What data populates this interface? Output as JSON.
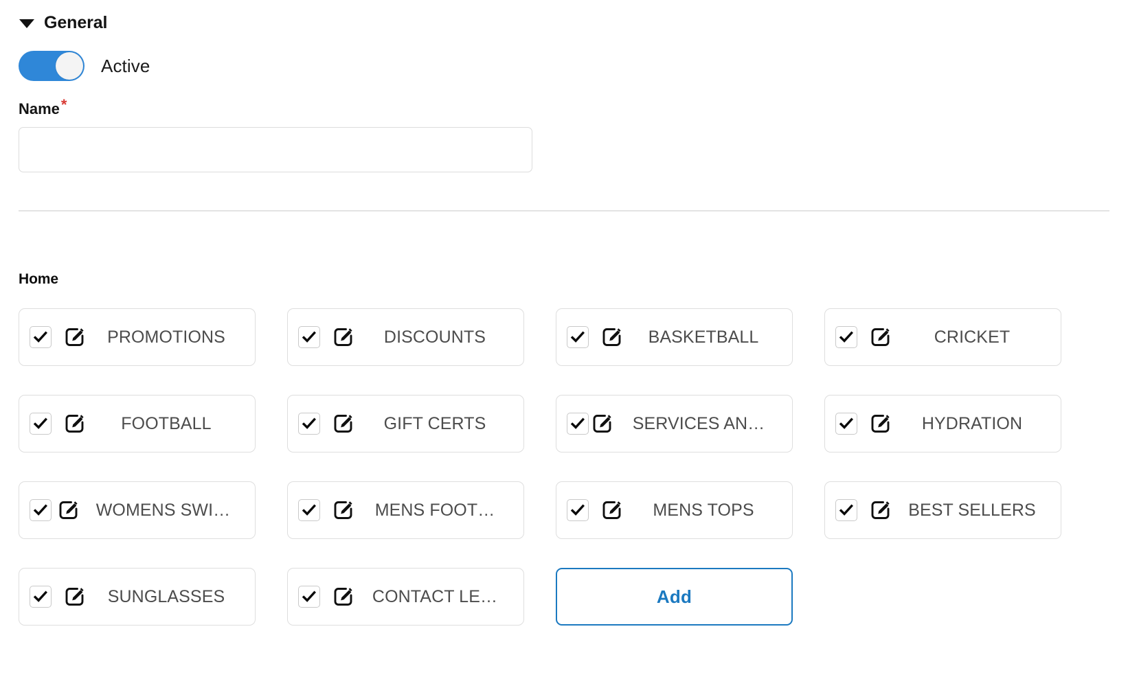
{
  "section": {
    "title": "General",
    "caret_icon": "chevron-down-icon",
    "expanded": true
  },
  "toggle": {
    "label": "Active",
    "state": "on",
    "on_color": "#2f87d8",
    "knob_color": "#f4f4f4"
  },
  "name_field": {
    "label": "Name",
    "required_marker": "*",
    "required_color": "#d83a34",
    "value": "",
    "placeholder": ""
  },
  "home_group": {
    "title": "Home",
    "chips": [
      {
        "label": "PROMOTIONS",
        "checked": true,
        "checkbox_icon": "checkbox-checked-icon",
        "edit_icon": "edit-pencil-icon",
        "spacing": "normal"
      },
      {
        "label": "DISCOUNTS",
        "checked": true,
        "checkbox_icon": "checkbox-checked-icon",
        "edit_icon": "edit-pencil-icon",
        "spacing": "normal"
      },
      {
        "label": "BASKETBALL",
        "checked": true,
        "checkbox_icon": "checkbox-checked-icon",
        "edit_icon": "edit-pencil-icon",
        "spacing": "normal"
      },
      {
        "label": "CRICKET",
        "checked": true,
        "checkbox_icon": "checkbox-checked-icon",
        "edit_icon": "edit-pencil-icon",
        "spacing": "normal"
      },
      {
        "label": "FOOTBALL",
        "checked": true,
        "checkbox_icon": "checkbox-checked-icon",
        "edit_icon": "edit-pencil-icon",
        "spacing": "normal"
      },
      {
        "label": "GIFT CERTS",
        "checked": true,
        "checkbox_icon": "checkbox-checked-icon",
        "edit_icon": "edit-pencil-icon",
        "spacing": "normal"
      },
      {
        "label": "SERVICES AN…",
        "checked": true,
        "checkbox_icon": "checkbox-checked-icon",
        "edit_icon": "edit-pencil-icon",
        "spacing": "tight"
      },
      {
        "label": "HYDRATION",
        "checked": true,
        "checkbox_icon": "checkbox-checked-icon",
        "edit_icon": "edit-pencil-icon",
        "spacing": "normal"
      },
      {
        "label": "WOMENS SWI…",
        "checked": true,
        "checkbox_icon": "checkbox-checked-icon",
        "edit_icon": "edit-pencil-icon",
        "spacing": "tight-sm"
      },
      {
        "label": "MENS FOOT…",
        "checked": true,
        "checkbox_icon": "checkbox-checked-icon",
        "edit_icon": "edit-pencil-icon",
        "spacing": "normal"
      },
      {
        "label": "MENS TOPS",
        "checked": true,
        "checkbox_icon": "checkbox-checked-icon",
        "edit_icon": "edit-pencil-icon",
        "spacing": "normal"
      },
      {
        "label": "BEST SELLERS",
        "checked": true,
        "checkbox_icon": "checkbox-checked-icon",
        "edit_icon": "edit-pencil-icon",
        "spacing": "normal"
      },
      {
        "label": "SUNGLASSES",
        "checked": true,
        "checkbox_icon": "checkbox-checked-icon",
        "edit_icon": "edit-pencil-icon",
        "spacing": "normal"
      },
      {
        "label": "CONTACT LE…",
        "checked": true,
        "checkbox_icon": "checkbox-checked-icon",
        "edit_icon": "edit-pencil-icon",
        "spacing": "normal"
      }
    ],
    "add_label": "Add",
    "add_accent_color": "#1b79c0"
  }
}
